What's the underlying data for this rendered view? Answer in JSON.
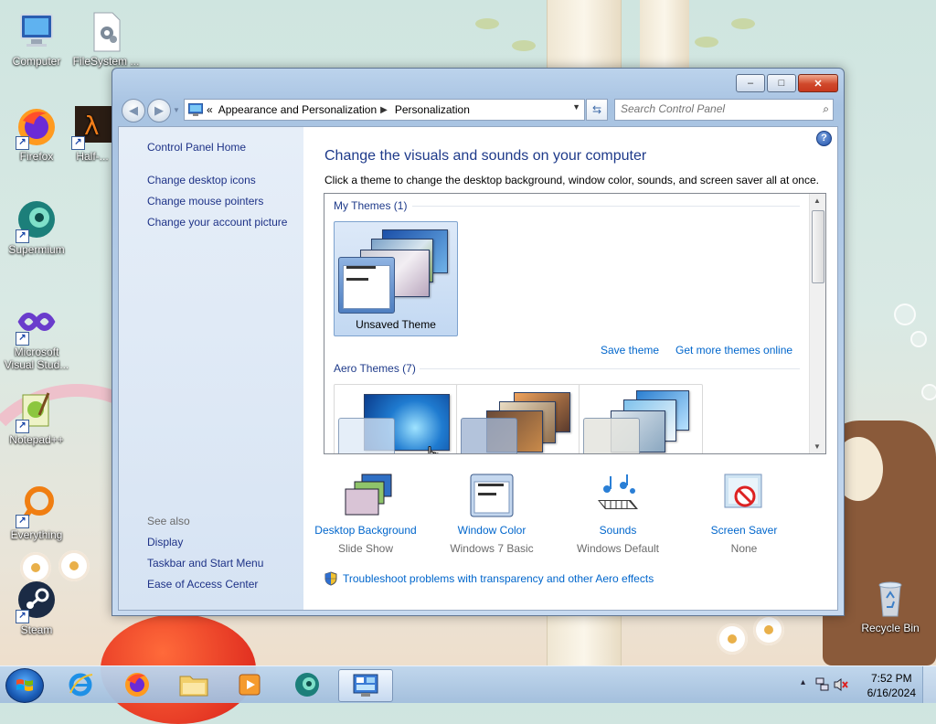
{
  "desktop": {
    "icons": [
      {
        "label": "Computer"
      },
      {
        "label": "FileSystem ..."
      },
      {
        "label": "Firefox"
      },
      {
        "label": "Half-..."
      },
      {
        "label": "Supermium"
      },
      {
        "label": "Microsoft Visual Stud..."
      },
      {
        "label": "Notepad++"
      },
      {
        "label": "Everything"
      },
      {
        "label": "Steam"
      },
      {
        "label": "Recycle Bin"
      }
    ]
  },
  "window": {
    "title_buttons": {
      "minimize": "–",
      "maximize": "□",
      "close": "✕"
    },
    "address": {
      "chevron": "«",
      "crumb1": "Appearance and Personalization",
      "crumb2": "Personalization"
    },
    "search": {
      "placeholder": "Search Control Panel"
    },
    "left_nav": {
      "home": "Control Panel Home",
      "links": [
        "Change desktop icons",
        "Change mouse pointers",
        "Change your account picture"
      ],
      "see_also_title": "See also",
      "see_also": [
        "Display",
        "Taskbar and Start Menu",
        "Ease of Access Center"
      ]
    },
    "main": {
      "help": "?",
      "heading": "Change the visuals and sounds on your computer",
      "subheading": "Click a theme to change the desktop background, window color, sounds, and screen saver all at once.",
      "my_themes_header": "My Themes (1)",
      "my_theme_name": "Unsaved Theme",
      "save_theme": "Save theme",
      "get_more": "Get more themes online",
      "aero_themes_header": "Aero Themes (7)",
      "bottom_items": [
        {
          "title": "Desktop Background",
          "subtitle": "Slide Show",
          "icon": "desktop-background-icon"
        },
        {
          "title": "Window Color",
          "subtitle": "Windows 7 Basic",
          "icon": "window-color-icon"
        },
        {
          "title": "Sounds",
          "subtitle": "Windows Default",
          "icon": "sounds-icon"
        },
        {
          "title": "Screen Saver",
          "subtitle": "None",
          "icon": "screen-saver-icon"
        }
      ],
      "troubleshoot": "Troubleshoot problems with transparency and other Aero effects"
    }
  },
  "taskbar": {
    "clock_time": "7:52 PM",
    "clock_date": "6/16/2024",
    "tray_arrow": "▴"
  }
}
